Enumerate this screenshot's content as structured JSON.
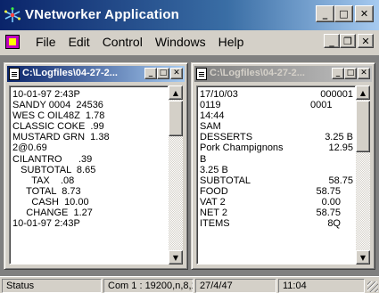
{
  "app": {
    "title": "VNetworker Application",
    "icon": "network-star-icon",
    "caption_buttons": {
      "minimize": "_",
      "maximize": "□",
      "close": "✕"
    }
  },
  "menu": {
    "items": [
      "File",
      "Edit",
      "Control",
      "Windows",
      "Help"
    ],
    "mdi_buttons": {
      "minimize": "_",
      "restore": "❐",
      "close": "✕"
    }
  },
  "windows": {
    "left": {
      "title": "C:\\Logfiles\\04-27-2...",
      "state": "active",
      "buttons": {
        "minimize": "_",
        "maximize": "□",
        "close": "✕"
      },
      "lines": [
        {
          "a": "10-01-97 2:43P"
        },
        {
          "a": "SANDY 0004  24536"
        },
        {
          "a": "WES C OIL48Z  1.78"
        },
        {
          "a": "CLASSIC COKE  .99"
        },
        {
          "a": "MUSTARD GRN  1.38"
        },
        {
          "a": "2@0.69"
        },
        {
          "a": "CILANTRO      .39"
        },
        {
          "a": "   SUBTOTAL  8.65"
        },
        {
          "a": "       TAX    .08"
        },
        {
          "a": "     TOTAL  8.73"
        },
        {
          "a": "       CASH  10.00"
        },
        {
          "a": "     CHANGE  1.27"
        },
        {
          "a": "10-01-97 2:43P"
        }
      ]
    },
    "right": {
      "title": "C:\\Logfiles\\04-27-2...",
      "state": "inactive",
      "buttons": {
        "minimize": "_",
        "maximize": "□",
        "close": "✕"
      },
      "lines": [
        {
          "a": "17/10/03",
          "r": "000001"
        },
        {
          "a": "0119",
          "m": "0001"
        },
        {
          "a": "14:44"
        },
        {
          "a": "SAM"
        },
        {
          "a": "DESSERTS",
          "r": "3.25 B"
        },
        {
          "a": "Pork Champignons",
          "r": "12.95"
        },
        {
          "a": "B"
        },
        {
          "a": "3.25 B"
        },
        {
          "a": "SUBTOTAL",
          "r": "58.75"
        },
        {
          "a": "FOOD",
          "r2": "58.75"
        },
        {
          "a": "VAT 2",
          "r2": "0.00"
        },
        {
          "a": "NET 2",
          "r2": "58.75"
        },
        {
          "a": "ITEMS",
          "r2": "8Q"
        }
      ]
    }
  },
  "status": {
    "label": "Status",
    "port": "Com 1 : 19200,n,8,1",
    "date": "27/4/47",
    "time": "11:04"
  }
}
